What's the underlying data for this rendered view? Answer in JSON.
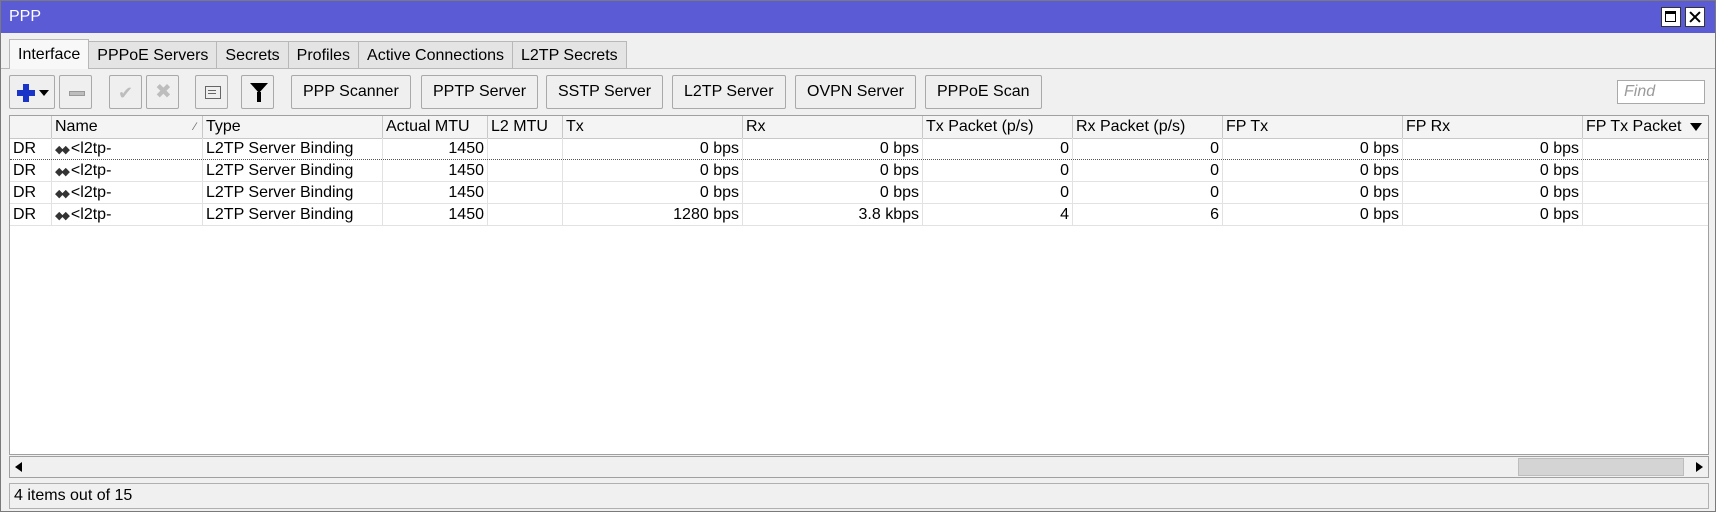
{
  "window": {
    "title": "PPP"
  },
  "tabs": [
    {
      "label": "Interface",
      "active": true
    },
    {
      "label": "PPPoE Servers"
    },
    {
      "label": "Secrets"
    },
    {
      "label": "Profiles"
    },
    {
      "label": "Active Connections"
    },
    {
      "label": "L2TP Secrets"
    }
  ],
  "toolbar": {
    "buttons": [
      "PPP Scanner",
      "PPTP Server",
      "SSTP Server",
      "L2TP Server",
      "OVPN Server",
      "PPPoE Scan"
    ],
    "find_placeholder": "Find"
  },
  "table": {
    "columns": [
      "",
      "Name",
      "Type",
      "Actual MTU",
      "L2 MTU",
      "Tx",
      "Rx",
      "Tx Packet (p/s)",
      "Rx Packet (p/s)",
      "FP Tx",
      "FP Rx",
      "FP Tx Packet"
    ],
    "rows": [
      {
        "flags": "DR",
        "name": "<l2tp-",
        "type": "L2TP Server Binding",
        "actual_mtu": "1450",
        "l2_mtu": "",
        "tx": "0 bps",
        "rx": "0 bps",
        "tx_packet": "0",
        "rx_packet": "0",
        "fp_tx": "0 bps",
        "fp_rx": "0 bps",
        "fp_tx_packet": ""
      },
      {
        "flags": "DR",
        "name": "<l2tp-",
        "type": "L2TP Server Binding",
        "actual_mtu": "1450",
        "l2_mtu": "",
        "tx": "0 bps",
        "rx": "0 bps",
        "tx_packet": "0",
        "rx_packet": "0",
        "fp_tx": "0 bps",
        "fp_rx": "0 bps",
        "fp_tx_packet": ""
      },
      {
        "flags": "DR",
        "name": "<l2tp-",
        "type": "L2TP Server Binding",
        "actual_mtu": "1450",
        "l2_mtu": "",
        "tx": "0 bps",
        "rx": "0 bps",
        "tx_packet": "0",
        "rx_packet": "0",
        "fp_tx": "0 bps",
        "fp_rx": "0 bps",
        "fp_tx_packet": ""
      },
      {
        "flags": "DR",
        "name": "<l2tp-",
        "type": "L2TP Server Binding",
        "actual_mtu": "1450",
        "l2_mtu": "",
        "tx": "1280 bps",
        "rx": "3.8 kbps",
        "tx_packet": "4",
        "rx_packet": "6",
        "fp_tx": "0 bps",
        "fp_rx": "0 bps",
        "fp_tx_packet": ""
      }
    ]
  },
  "status": {
    "text": "4 items out of 15"
  }
}
